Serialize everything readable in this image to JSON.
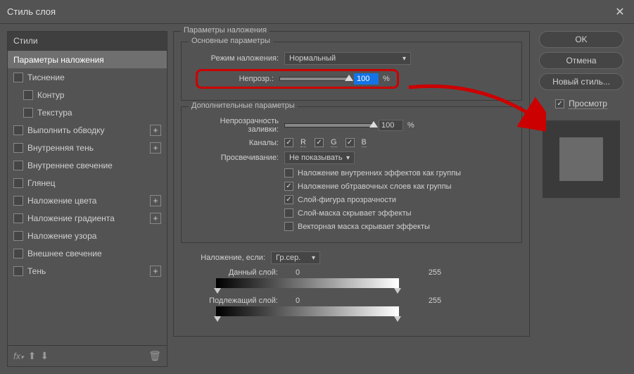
{
  "window": {
    "title": "Стиль слоя"
  },
  "sidebar": {
    "header": "Стили",
    "items": [
      {
        "label": "Параметры наложения",
        "selected": true
      },
      {
        "label": "Тиснение",
        "cb": true
      },
      {
        "label": "Контур",
        "cb": true,
        "child": true
      },
      {
        "label": "Текстура",
        "cb": true,
        "child": true
      },
      {
        "label": "Выполнить обводку",
        "cb": true,
        "plus": true
      },
      {
        "label": "Внутренняя тень",
        "cb": true,
        "plus": true
      },
      {
        "label": "Внутреннее свечение",
        "cb": true
      },
      {
        "label": "Глянец",
        "cb": true
      },
      {
        "label": "Наложение цвета",
        "cb": true,
        "plus": true
      },
      {
        "label": "Наложение градиента",
        "cb": true,
        "plus": true
      },
      {
        "label": "Наложение узора",
        "cb": true
      },
      {
        "label": "Внешнее свечение",
        "cb": true
      },
      {
        "label": "Тень",
        "cb": true,
        "plus": true
      }
    ]
  },
  "main": {
    "group_title": "Параметры наложения",
    "basic": {
      "title": "Основные параметры",
      "mode_label": "Режим наложения:",
      "mode_value": "Нормальный",
      "opacity_label": "Непрозр.:",
      "opacity_value": "100",
      "unit": "%"
    },
    "advanced": {
      "title": "Дополнительные параметры",
      "fill_label": "Непрозрачность заливки:",
      "fill_value": "100",
      "channels_label": "Каналы:",
      "ch_r": "R",
      "ch_g": "G",
      "ch_b": "B",
      "knockout_label": "Просвечивание:",
      "knockout_value": "Не показывать",
      "c1": "Наложение внутренних эффектов как группы",
      "c2": "Наложение обтравочных слоев как группы",
      "c3": "Слой-фигура прозрачности",
      "c4": "Слой-маска скрывает эффекты",
      "c5": "Векторная маска скрывает эффекты"
    },
    "blendif": {
      "label": "Наложение, если:",
      "value": "Гр.сер.",
      "this_layer": "Данный слой:",
      "under_layer": "Подлежащий слой:",
      "v0": "0",
      "v255": "255"
    }
  },
  "buttons": {
    "ok": "OK",
    "cancel": "Отмена",
    "newstyle": "Новый стиль...",
    "preview": "Просмотр"
  }
}
